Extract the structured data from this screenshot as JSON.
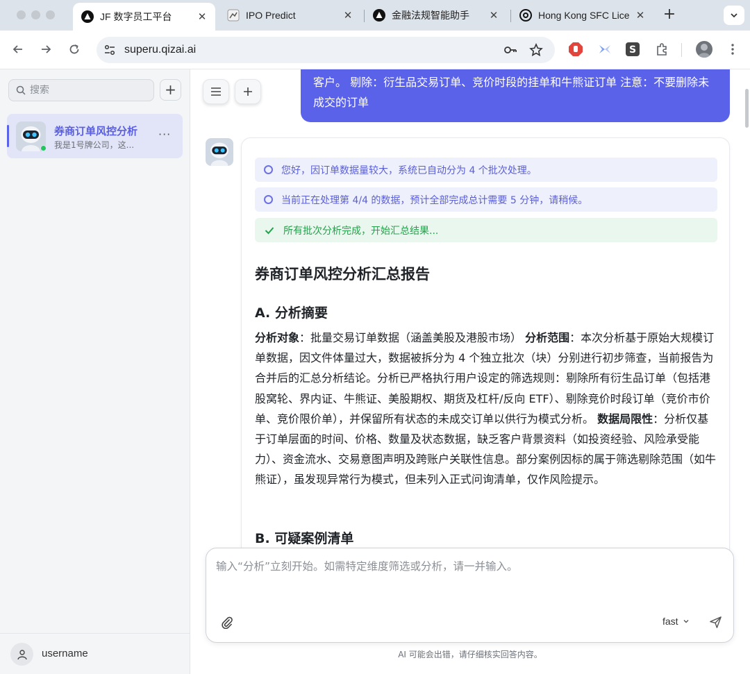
{
  "browser": {
    "tabs": [
      {
        "title": "JF 数字员工平台",
        "active": true
      },
      {
        "title": "IPO Predict",
        "active": false
      },
      {
        "title": "金融法规智能助手",
        "active": false
      },
      {
        "title": "Hong Kong SFC Lice",
        "active": false
      }
    ],
    "url": "superu.qizai.ai",
    "icons": [
      "back-arrow-icon",
      "forward-arrow-icon",
      "reload-icon",
      "site-settings-icon",
      "key-icon",
      "star-icon",
      "extensions-icon",
      "menu-dots-icon"
    ]
  },
  "sidebar": {
    "search_placeholder": "搜索",
    "add_label": "+",
    "conversations": [
      {
        "title": "券商订单风控分析",
        "subtitle": "我是1号牌公司，这...",
        "more": "···",
        "online": true
      }
    ],
    "user": {
      "name": "username"
    }
  },
  "chat": {
    "user_message": "客户。 剔除：衍生品交易订单、竞价时段的挂单和牛熊证订单 注意：不要删除未成交的订单",
    "statuses": [
      {
        "text": "您好，因订单数据量较大，系统已自动分为 4 个批次处理。",
        "kind": "info"
      },
      {
        "text": "当前正在处理第 4/4 的数据，预计全部完成总计需要 5 分钟，请稍候。",
        "kind": "info"
      },
      {
        "text": "所有批次分析完成，开始汇总结果...",
        "kind": "done"
      }
    ],
    "report": {
      "title": "券商订单风控分析汇总报告",
      "section_a": "A. 分析摘要",
      "label_object": "分析对象",
      "text_object": "：批量交易订单数据（涵盖美股及港股市场） ",
      "label_scope": "分析范围",
      "text_scope": "：本次分析基于原始大规模订单数据，因文件体量过大，数据被拆分为 4 个独立批次（块）分别进行初步筛查，当前报告为合并后的汇总分析结论。分析已严格执行用户设定的筛选规则：剔除所有衍生品订单（包括港股窝轮、界内证、牛熊证、美股期权、期货及杠杆/反向 ETF）、剔除竞价时段订单（竞价市价单、竞价限价单），并保留所有状态的未成交订单以供行为模式分析。 ",
      "label_limits": "数据局限性",
      "text_limits": "：分析仅基于订单层面的时间、价格、数量及状态数据，缺乏客户背景资料（如投资经验、风险承受能力）、资金流水、交易意图声明及跨账户关联性信息。部分案例因标的属于筛选剔除范围（如牛熊证），虽发现异常行为模式，但未列入正式问询清单，仅作风险提示。",
      "section_b": "B. 可疑案例清单"
    }
  },
  "composer": {
    "placeholder": "输入“分析”立刻开始。如需特定维度筛选或分析，请一并输入。",
    "model": "fast",
    "disclaimer": "AI 可能会出错，请仔细核实回答内容。"
  },
  "colors": {
    "accent": "#5b62ea",
    "status_info_bg": "#eef0fb",
    "status_done_bg": "#e9f7ee",
    "online": "#22c55e"
  }
}
